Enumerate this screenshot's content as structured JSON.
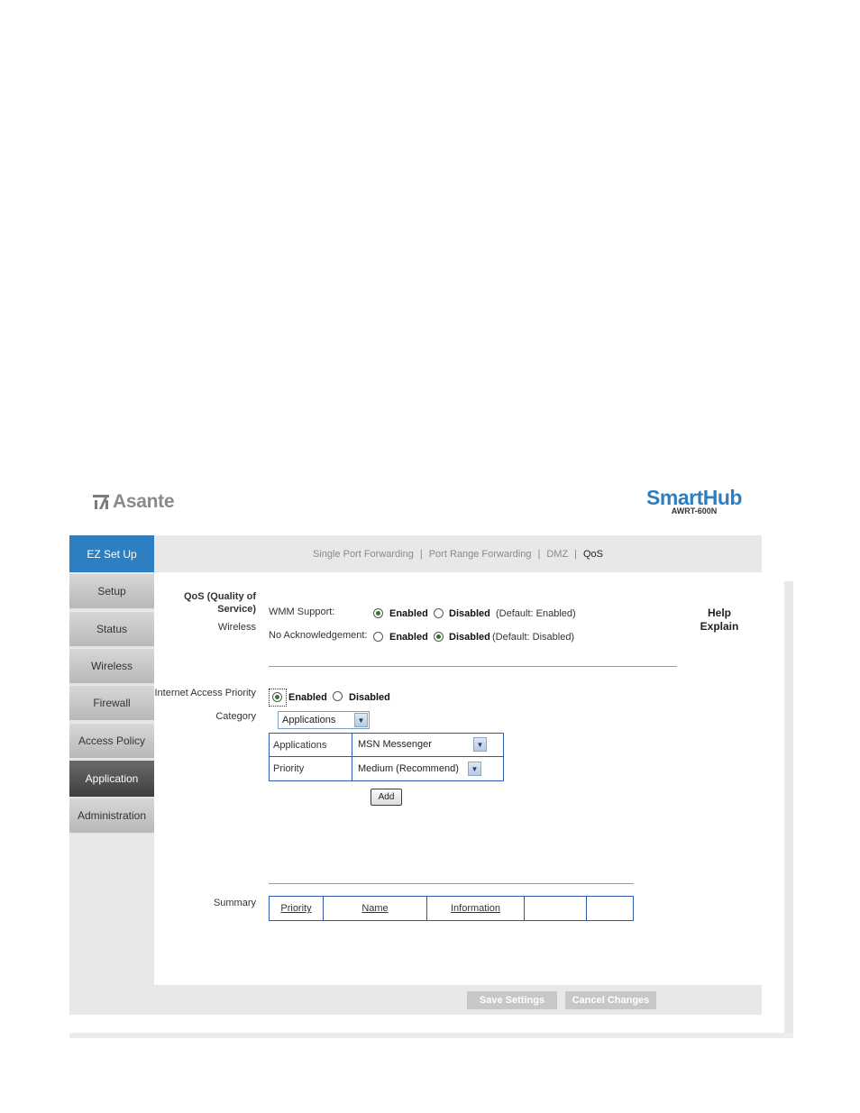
{
  "header": {
    "brand_left": "Asante",
    "brand_right": "SmartHub",
    "model": "AWRT-600N"
  },
  "nav": {
    "ez_setup": "EZ Set Up",
    "items": [
      "Setup",
      "Status",
      "Wireless",
      "Firewall",
      "Access Policy",
      "Application",
      "Administration"
    ],
    "active": "Application"
  },
  "tabs": {
    "items": [
      "Single Port Forwarding",
      "Port Range Forwarding",
      "DMZ",
      "QoS"
    ],
    "separator": "|",
    "current": "QoS"
  },
  "qos": {
    "section_title_1": "QoS (Quality of",
    "section_title_2": "Service)",
    "wireless_label": "Wireless",
    "wmm_label": "WMM Support:",
    "wmm_enabled": "Enabled",
    "wmm_disabled": "Disabled",
    "wmm_default": "(Default: Enabled)",
    "wmm_value": "Enabled",
    "noack_label": "No Acknowledgement:",
    "noack_enabled": "Enabled",
    "noack_disabled": "Disabled",
    "noack_default": "(Default: Disabled)",
    "noack_value": "Disabled"
  },
  "iap": {
    "label": "Internet Access Priority",
    "enabled": "Enabled",
    "disabled": "Disabled",
    "value": "Enabled",
    "category_label": "Category",
    "category_value": "Applications",
    "row1_label": "Applications",
    "row1_value": "MSN Messenger",
    "row2_label": "Priority",
    "row2_value": "Medium (Recommend)",
    "add_button": "Add"
  },
  "summary": {
    "label": "Summary",
    "columns": [
      "Priority",
      "Name",
      "Information",
      "",
      ""
    ]
  },
  "help": {
    "line1": "Help",
    "line2": "Explain"
  },
  "footer": {
    "save": "Save Settings",
    "cancel": "Cancel Changes"
  }
}
